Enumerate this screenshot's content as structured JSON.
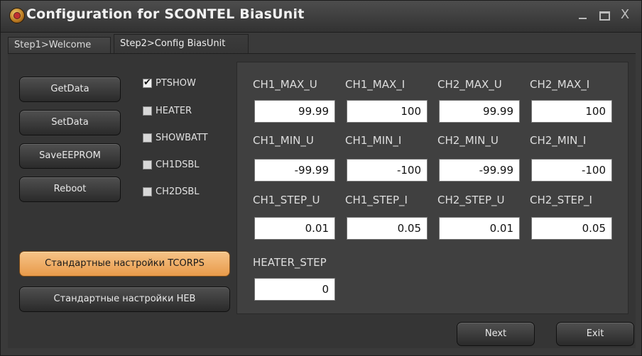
{
  "window": {
    "title": "Configuration for SCONTEL BiasUnit",
    "controls": {
      "minimize": "_",
      "maximize": "□",
      "close": "X"
    }
  },
  "tabs": [
    {
      "label": "Step1>Welcome",
      "active": false
    },
    {
      "label": "Step2>Config BiasUnit",
      "active": true
    }
  ],
  "side_buttons": {
    "get_data": "GetData",
    "set_data": "SetData",
    "save_eeprom": "SaveEEPROM",
    "reboot": "Reboot"
  },
  "checkboxes": [
    {
      "label": "PTSHOW",
      "checked": true
    },
    {
      "label": "HEATER",
      "checked": false
    },
    {
      "label": "SHOWBATT",
      "checked": false
    },
    {
      "label": "CH1DSBL",
      "checked": false
    },
    {
      "label": "CH2DSBL",
      "checked": false
    }
  ],
  "presets": {
    "tcorps": "Стандартные настройки TCORPS",
    "heb": "Стандартные настройки HEB"
  },
  "params": {
    "row1": {
      "labels": [
        "CH1_MAX_U",
        "CH1_MAX_I",
        "CH2_MAX_U",
        "CH2_MAX_I"
      ],
      "values": [
        "99.99",
        "100",
        "99.99",
        "100"
      ]
    },
    "row2": {
      "labels": [
        "CH1_MIN_U",
        "CH1_MIN_I",
        "CH2_MIN_U",
        "CH2_MIN_I"
      ],
      "values": [
        "-99.99",
        "-100",
        "-99.99",
        "-100"
      ]
    },
    "row3": {
      "labels": [
        "CH1_STEP_U",
        "CH1_STEP_I",
        "CH2_STEP_U",
        "CH2_STEP_I"
      ],
      "values": [
        "0.01",
        "0.05",
        "0.01",
        "0.05"
      ]
    },
    "heater_step": {
      "label": "HEATER_STEP",
      "value": "0"
    }
  },
  "footer": {
    "next": "Next",
    "exit": "Exit"
  },
  "colors": {
    "window_bg": "#3a3a3a",
    "panel_bg": "#404040",
    "accent_button": "#f0b070"
  }
}
